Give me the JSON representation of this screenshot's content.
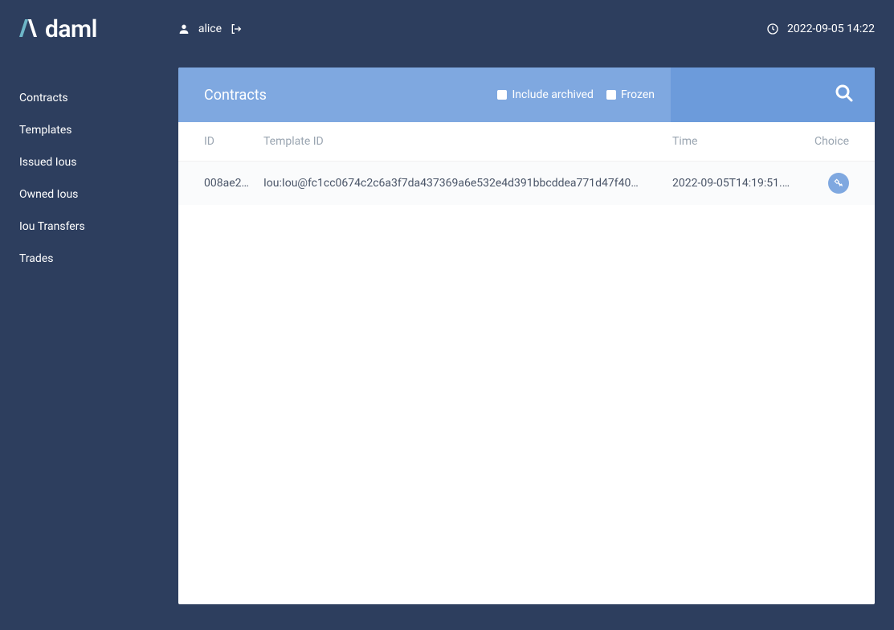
{
  "brand": "daml",
  "user": {
    "name": "alice"
  },
  "clock": "2022-09-05 14:22",
  "sidebar": {
    "items": [
      {
        "label": "Contracts"
      },
      {
        "label": "Templates"
      },
      {
        "label": "Issued Ious"
      },
      {
        "label": "Owned Ious"
      },
      {
        "label": "Iou Transfers"
      },
      {
        "label": "Trades"
      }
    ]
  },
  "panel": {
    "title": "Contracts",
    "toggles": {
      "include_archived_label": "Include archived",
      "frozen_label": "Frozen"
    },
    "columns": {
      "id": "ID",
      "template_id": "Template ID",
      "time": "Time",
      "choice": "Choice"
    },
    "rows": [
      {
        "id": "008ae2…",
        "template_id": "Iou:Iou@fc1cc0674c2c6a3f7da437369a6e532e4d391bbcddea771d47f40…",
        "time": "2022-09-05T14:19:51.9…"
      }
    ]
  }
}
